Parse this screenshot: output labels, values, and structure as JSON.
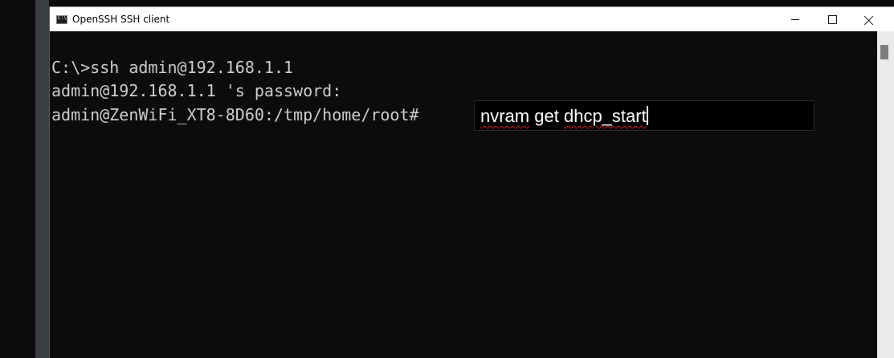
{
  "window": {
    "title": "OpenSSH SSH client"
  },
  "terminal": {
    "lines": [
      "C:\\>ssh admin@192.168.1.1",
      "admin@192.168.1.1 's password:",
      "admin@ZenWiFi_XT8-8D60:/tmp/home/root#"
    ]
  },
  "ime": {
    "word1": "nvram",
    "word2": "get",
    "word3": "dhcp_start"
  },
  "icons": {
    "app": "console-icon",
    "minimize": "minimize-icon",
    "maximize": "maximize-icon",
    "close": "close-icon"
  },
  "colors": {
    "console_bg": "#0c0c0c",
    "console_text": "#cccccc",
    "titlebar_bg": "#ffffff",
    "spellcheck": "#d11c1c"
  }
}
